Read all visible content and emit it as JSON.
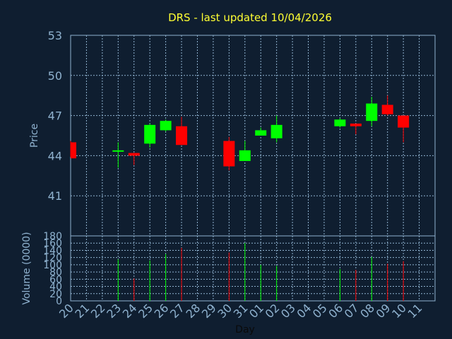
{
  "chart_data": {
    "type": "candlestick",
    "title": "DRS - last updated 10/04/2026",
    "price_axis": {
      "ylabel": "Price",
      "ylim": [
        38,
        53
      ],
      "ticks": [
        53,
        50,
        47,
        44,
        41
      ],
      "grid": true
    },
    "volume_axis": {
      "ylabel": "Volume (0000)",
      "ylim": [
        0,
        180
      ],
      "ticks": [
        180,
        160,
        140,
        120,
        100,
        80,
        60,
        40,
        20,
        0
      ],
      "grid": true
    },
    "xlabel": "Day",
    "x_ticks": [
      "20",
      "21",
      "22",
      "23",
      "24",
      "25",
      "26",
      "27",
      "28",
      "29",
      "30",
      "31",
      "01",
      "02",
      "03",
      "04",
      "05",
      "06",
      "07",
      "08",
      "09",
      "10",
      "11"
    ],
    "colors": {
      "up": "#00ff00",
      "down": "#ff0000",
      "grid": "#8fb2cf",
      "background": "#0f1e30",
      "text": "#8fb2cf",
      "title": "#ffff33"
    },
    "candles": [
      {
        "day": "20",
        "open": 45.0,
        "high": 45.1,
        "low": 43.9,
        "close": 43.8,
        "volume": 0
      },
      {
        "day": "23",
        "open": 44.3,
        "high": 45.0,
        "low": 43.1,
        "close": 44.4,
        "volume": 115
      },
      {
        "day": "24",
        "open": 44.2,
        "high": 44.2,
        "low": 43.3,
        "close": 44.0,
        "volume": 62
      },
      {
        "day": "25",
        "open": 44.9,
        "high": 46.4,
        "low": 44.6,
        "close": 46.3,
        "volume": 112
      },
      {
        "day": "26",
        "open": 45.9,
        "high": 46.7,
        "low": 45.8,
        "close": 46.6,
        "volume": 130
      },
      {
        "day": "27",
        "open": 46.2,
        "high": 46.9,
        "low": 44.8,
        "close": 44.8,
        "volume": 147
      },
      {
        "day": "30",
        "open": 45.1,
        "high": 45.4,
        "low": 42.9,
        "close": 43.2,
        "volume": 134
      },
      {
        "day": "31",
        "open": 43.6,
        "high": 45.1,
        "low": 43.6,
        "close": 44.4,
        "volume": 160
      },
      {
        "day": "01",
        "open": 45.5,
        "high": 46.1,
        "low": 45.5,
        "close": 45.9,
        "volume": 100
      },
      {
        "day": "02",
        "open": 45.3,
        "high": 47.0,
        "low": 45.0,
        "close": 46.3,
        "volume": 97
      },
      {
        "day": "06",
        "open": 46.2,
        "high": 46.8,
        "low": 46.1,
        "close": 46.7,
        "volume": 88
      },
      {
        "day": "07",
        "open": 46.4,
        "high": 46.4,
        "low": 45.6,
        "close": 46.2,
        "volume": 86
      },
      {
        "day": "08",
        "open": 46.6,
        "high": 48.4,
        "low": 46.2,
        "close": 47.9,
        "volume": 122
      },
      {
        "day": "09",
        "open": 47.8,
        "high": 48.5,
        "low": 47.0,
        "close": 47.1,
        "volume": 103
      },
      {
        "day": "10",
        "open": 47.0,
        "high": 47.0,
        "low": 45.0,
        "close": 46.1,
        "volume": 110
      }
    ]
  }
}
